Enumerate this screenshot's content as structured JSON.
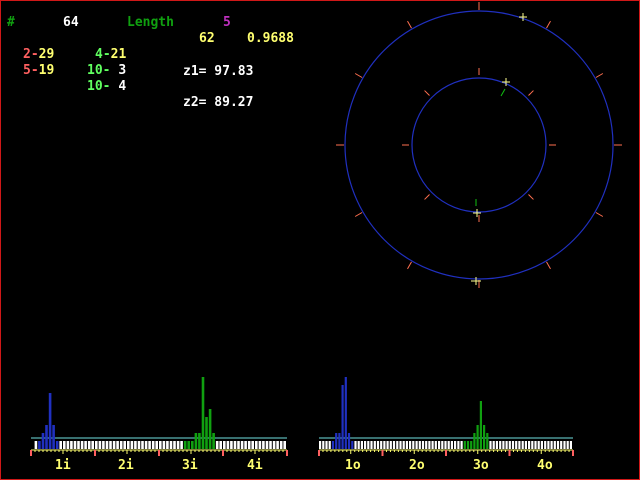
{
  "colors": {
    "red": "#ff6060",
    "yellow": "#ffff70",
    "green": "#60ff60",
    "white": "#ffffff",
    "blue": "#2030c0",
    "dark_green": "#10a010",
    "magenta": "#c030c0",
    "cyan": "#70e0e0",
    "tick_orange": "#ff7050"
  },
  "header": {
    "hash_label": "#",
    "count": "64",
    "length_label": "Length",
    "length_value": "5",
    "sub_count": "62",
    "ratio": "0.9688"
  },
  "pairs": [
    {
      "a": "2",
      "b": "29",
      "color_a": "#ff6060",
      "color_b": "#ffff70"
    },
    {
      "a": "4",
      "b": "21",
      "color_a": "#60ff60",
      "color_b": "#ffff70"
    },
    {
      "a": "5",
      "b": "19",
      "color_a": "#ff6060",
      "color_b": "#ffff70"
    },
    {
      "a": "10",
      "b": "3",
      "color_a": "#60ff60",
      "color_b": "#ffffff"
    },
    {
      "a": "10",
      "b": "4",
      "color_a": "#60ff60",
      "color_b": "#ffffff"
    }
  ],
  "readouts": {
    "z1": "z1= 97.83",
    "z2": "z2= 89.27"
  },
  "histograms": [
    {
      "id": "inner",
      "axis_labels": [
        "1i",
        "2i",
        "3i",
        "4i"
      ],
      "baseline_level": 1.0,
      "bars": [
        0,
        1,
        1,
        2,
        3,
        7,
        3,
        1,
        1,
        1,
        1,
        1,
        1,
        1,
        1,
        1,
        1,
        1,
        1,
        1,
        1,
        1,
        1,
        1,
        1,
        1,
        1,
        1,
        1,
        1,
        1,
        1,
        1,
        1,
        1,
        1,
        1,
        1,
        1,
        1,
        1,
        1,
        1,
        1,
        1,
        1,
        2,
        2,
        9,
        4,
        5,
        2,
        1,
        1,
        1,
        1,
        1,
        1,
        1,
        1,
        1,
        1,
        1,
        1,
        1,
        1,
        1,
        1,
        1,
        1,
        1,
        1
      ],
      "highlight_blue": [
        2,
        3,
        4,
        5,
        6,
        7
      ],
      "highlight_green": [
        43,
        44,
        45,
        46,
        47,
        48,
        49,
        50,
        51
      ]
    },
    {
      "id": "outer",
      "axis_labels": [
        "1o",
        "2o",
        "3o",
        "4o"
      ],
      "baseline_level": 1.0,
      "bars": [
        1,
        1,
        1,
        1,
        1,
        2,
        2,
        8,
        9,
        2,
        1,
        1,
        1,
        1,
        1,
        1,
        1,
        1,
        1,
        1,
        1,
        1,
        1,
        1,
        1,
        1,
        1,
        1,
        1,
        1,
        1,
        1,
        1,
        1,
        1,
        1,
        1,
        1,
        1,
        1,
        1,
        1,
        1,
        1,
        1,
        1,
        1,
        1,
        2,
        3,
        6,
        3,
        2,
        1,
        1,
        1,
        1,
        1,
        1,
        1,
        1,
        1,
        1,
        1,
        1,
        1,
        1,
        1,
        1,
        1,
        1,
        1,
        1,
        1,
        1,
        1,
        1,
        1,
        1
      ],
      "highlight_blue": [
        4,
        5,
        6,
        7,
        8,
        9,
        10
      ],
      "highlight_green": [
        45,
        46,
        47,
        48,
        49,
        50,
        51,
        52
      ]
    }
  ]
}
